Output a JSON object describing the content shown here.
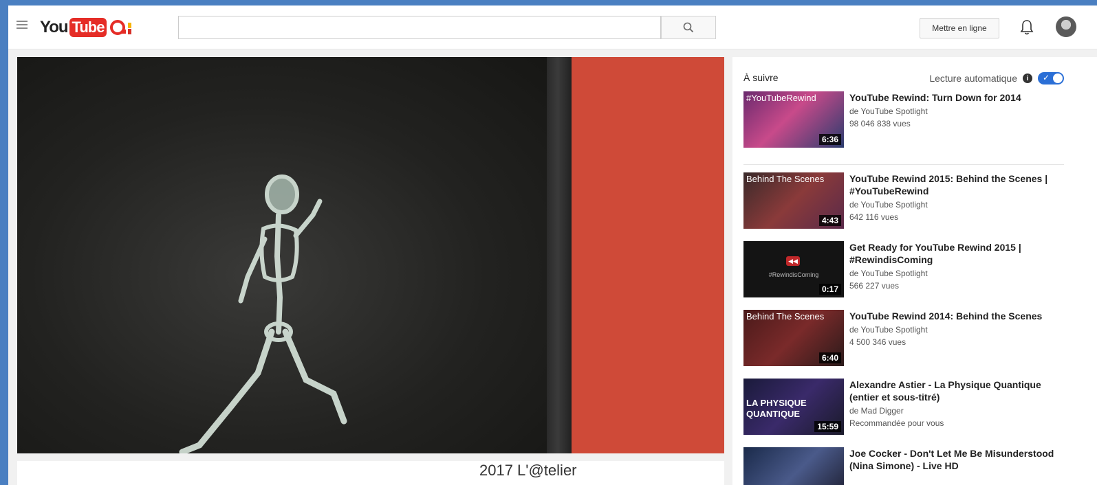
{
  "header": {
    "logo_you": "You",
    "logo_tube": "Tube",
    "search_placeholder": "",
    "upload_label": "Mettre en ligne"
  },
  "icons": {
    "menu": "hamburger-menu-icon",
    "search": "search-icon",
    "notifications": "bell-icon",
    "avatar": "avatar",
    "autoplay_info": "info-icon"
  },
  "watermark": "2017 L'@telier",
  "sidebar": {
    "up_next_label": "À suivre",
    "autoplay_label": "Lecture automatique",
    "autoplay_on": true,
    "videos": [
      {
        "title": "YouTube Rewind: Turn Down for 2014",
        "channel": "de YouTube Spotlight",
        "meta": "98 046 838 vues",
        "duration": "6:36",
        "thumb_caption": "#YouTubeRewind"
      },
      {
        "title": "YouTube Rewind 2015: Behind the Scenes | #YouTubeRewind",
        "channel": "de YouTube Spotlight",
        "meta": "642 116 vues",
        "duration": "4:43",
        "thumb_caption": "Behind The Scenes"
      },
      {
        "title": "Get Ready for YouTube Rewind 2015 | #RewindisComing",
        "channel": "de YouTube Spotlight",
        "meta": "566 227 vues",
        "duration": "0:17",
        "thumb_caption": "#RewindisComing"
      },
      {
        "title": "YouTube Rewind 2014: Behind the Scenes",
        "channel": "de YouTube Spotlight",
        "meta": "4 500 346 vues",
        "duration": "6:40",
        "thumb_caption": "Behind The Scenes"
      },
      {
        "title": "Alexandre Astier - La Physique Quantique (entier et sous-titré)",
        "channel": "de Mad Digger",
        "meta": "Recommandée pour vous",
        "duration": "15:59",
        "thumb_caption": "LA PHYSIQUE QUANTIQUE"
      },
      {
        "title": "Joe Cocker - Don't Let Me Be Misunderstood (Nina Simone) - Live HD",
        "channel": "",
        "meta": "",
        "duration": "",
        "thumb_caption": ""
      }
    ]
  },
  "colors": {
    "brand_red": "#e52d27",
    "toggle_blue": "#2b6fd6",
    "video_red_panel": "#cf4a38"
  }
}
